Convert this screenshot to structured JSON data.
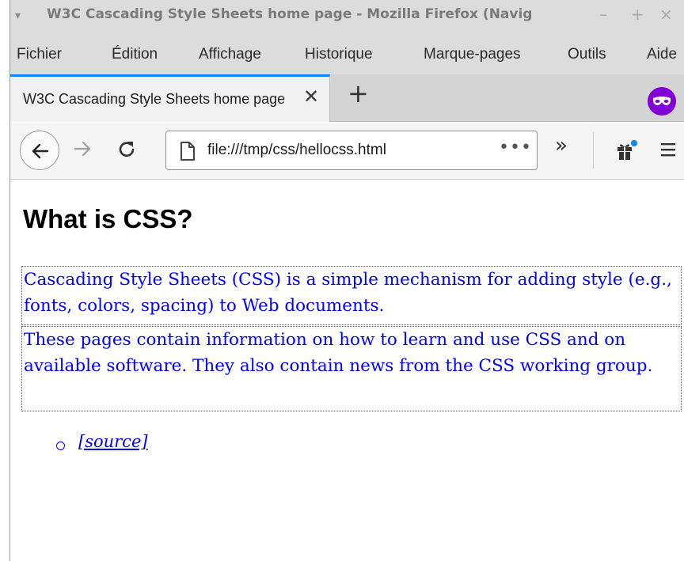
{
  "window": {
    "title": "W3C Cascading Style Sheets home page - Mozilla Firefox (Navig",
    "menu_glyph": "▾",
    "minimize": "–",
    "maximize": "+",
    "close": "×"
  },
  "menubar": {
    "items": [
      "Fichier",
      "Édition",
      "Affichage",
      "Historique",
      "Marque-pages",
      "Outils",
      "Aide"
    ]
  },
  "tabs": {
    "active_title": "W3C Cascading Style Sheets home page",
    "close_glyph": "✕",
    "new_tab_glyph": "+"
  },
  "navbar": {
    "url": "file:///tmp/css/hellocss.html",
    "more_glyph": "•••",
    "overflow_glyph": "»"
  },
  "page": {
    "heading": "What is CSS?",
    "paragraph1": "Cascading Style Sheets (CSS) is a simple mechanism for adding style (e.g., fonts, colors, spacing) to Web documents.",
    "paragraph2": "These pages contain information on how to learn and use CSS and on available software. They also contain news from the CSS working group.",
    "source_link": "[source]"
  },
  "colors": {
    "accent": "#0a84ff",
    "private_badge": "#8000d7",
    "paragraph_text": "#0000ff",
    "link": "#0000ee"
  },
  "icons": [
    "menu-icon",
    "close-tab-icon",
    "new-tab-icon",
    "private-browsing-icon",
    "back-arrow-icon",
    "forward-arrow-icon",
    "reload-icon",
    "page-icon",
    "page-actions-icon",
    "overflow-icon",
    "gift-icon",
    "hamburger-icon"
  ]
}
